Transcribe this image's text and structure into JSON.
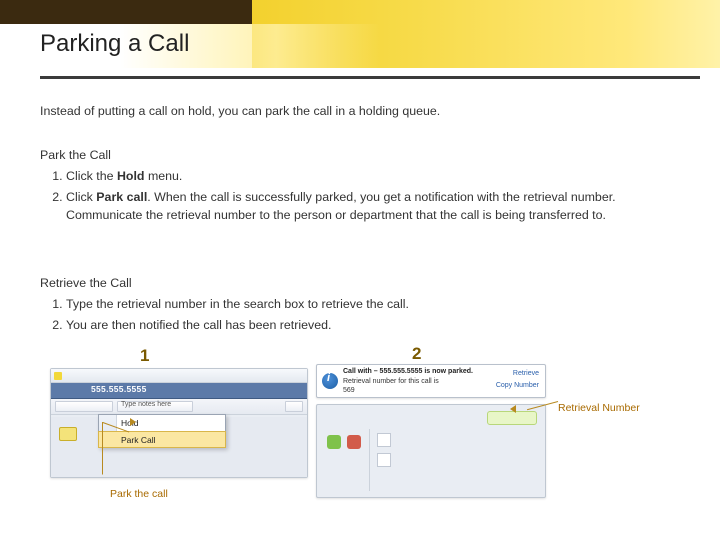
{
  "title": "Parking a Call",
  "intro": "Instead of putting a call on hold, you can park the call in a holding queue.",
  "park": {
    "heading": "Park the Call",
    "s1_pre": "Click the ",
    "s1_b": "Hold",
    "s1_post": " menu.",
    "s2_pre": "Click ",
    "s2_b": "Park call",
    "s2_post": ". When the call is successfully parked, you get a notification with the retrieval number. Communicate the retrieval number to the person or department that the call is being transferred to."
  },
  "retrieve": {
    "heading": "Retrieve the Call",
    "s1": "Type the retrieval number in the search box to retrieve the call.",
    "s2": "You are then notified the call has been retrieved."
  },
  "labels": {
    "one": "1",
    "two": "2"
  },
  "callouts": {
    "park": "Park the call",
    "retrieval": "Retrieval Number"
  },
  "fig1": {
    "phone_number": "555.555.5555",
    "toolbar_hint": "Type notes here",
    "menu": {
      "item1": "Hold",
      "item2": "Park Call"
    }
  },
  "fig2": {
    "toast_title": "Call with – 555.555.5555   is now parked.",
    "toast_line2": "Retrieval  number  for  this  call  is",
    "toast_number": "569",
    "toast_action1": "Retrieve",
    "toast_action2": "Copy Number"
  }
}
